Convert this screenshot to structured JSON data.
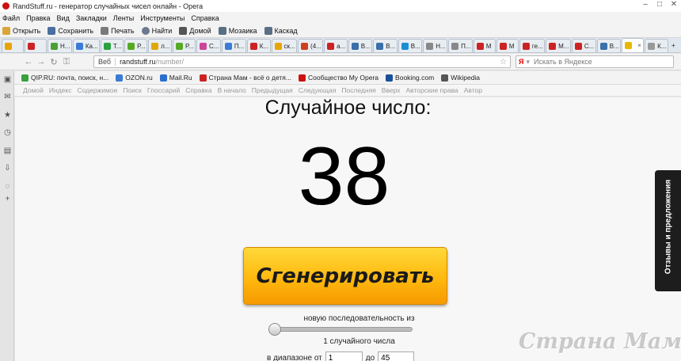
{
  "window": {
    "title": "RandStuff.ru - генератор случайных чисел онлайн - Opera"
  },
  "menu": [
    "Файл",
    "Правка",
    "Вид",
    "Закладки",
    "Ленты",
    "Инструменты",
    "Справка"
  ],
  "toolbar": [
    "Открыть",
    "Сохранить",
    "Печать",
    "Найти",
    "Домой",
    "Мозаика",
    "Каскад"
  ],
  "tabs": [
    {
      "label": "",
      "color": "#e8a400"
    },
    {
      "label": "",
      "color": "#cc2222"
    },
    {
      "label": "Н...",
      "color": "#4aa034"
    },
    {
      "label": "Ка...",
      "color": "#3a7bd5"
    },
    {
      "label": "Т...",
      "color": "#2aa040"
    },
    {
      "label": "Р...",
      "color": "#55aa22"
    },
    {
      "label": "л...",
      "color": "#e0a800"
    },
    {
      "label": "Р...",
      "color": "#55aa22"
    },
    {
      "label": "С...",
      "color": "#cc4499"
    },
    {
      "label": "П...",
      "color": "#3a7bd5"
    },
    {
      "label": "К...",
      "color": "#cc2222"
    },
    {
      "label": "ск...",
      "color": "#e8a400"
    },
    {
      "label": "(4...",
      "color": "#d04020"
    },
    {
      "label": "а...",
      "color": "#cc2222"
    },
    {
      "label": "В...",
      "color": "#3a6fa8"
    },
    {
      "label": "В...",
      "color": "#3a6fa8"
    },
    {
      "label": "В...",
      "color": "#1a8fd6"
    },
    {
      "label": "Н...",
      "color": "#888888"
    },
    {
      "label": "П...",
      "color": "#888888"
    },
    {
      "label": "М",
      "color": "#cc2222"
    },
    {
      "label": "М",
      "color": "#cc2222"
    },
    {
      "label": "ге...",
      "color": "#cc2222"
    },
    {
      "label": "М...",
      "color": "#cc2222"
    },
    {
      "label": "С...",
      "color": "#cc2222"
    },
    {
      "label": "В...",
      "color": "#3a6fa8"
    },
    {
      "label": "",
      "color": "#e8b800",
      "active": true
    },
    {
      "label": "К...",
      "color": "#999999"
    }
  ],
  "tab_add": "+",
  "address": {
    "badge": "Веб",
    "host": "randstuff.ru",
    "path": "/number/"
  },
  "search": {
    "placeholder": "Искать в Яндексе",
    "engine": "Я"
  },
  "bookmarks": [
    {
      "label": "QIP.RU: почта, поиск, н...",
      "color": "#3aa040"
    },
    {
      "label": "OZON.ru",
      "color": "#3a7bd5"
    },
    {
      "label": "Mail.Ru",
      "color": "#2a6fd0"
    },
    {
      "label": "Страна Мам - всё о детя...",
      "color": "#cc2222"
    },
    {
      "label": "Сообщество My Opera",
      "color": "#cc1111"
    },
    {
      "label": "Booking.com",
      "color": "#1a4f9c"
    },
    {
      "label": "Wikipedia",
      "color": "#555555"
    }
  ],
  "navbar": [
    "Домой",
    "Индекс",
    "Содержимое",
    "Поиск",
    "Глоссарий",
    "Справка",
    "В начало",
    "Предыдущая",
    "Следующая",
    "Последняя",
    "Вверх",
    "Авторские права",
    "Автор"
  ],
  "page": {
    "heading": "Случайное число:",
    "number": "38",
    "button": "Сгенерировать",
    "sequence_label": "новую последовательность из",
    "sequence_count": 1,
    "count_label": "1 случайного числа",
    "range_from_label": "в диапазоне от",
    "range_from": "1",
    "range_to_label": "до",
    "range_to": "45"
  },
  "feedback": "Отзывы и предложения",
  "watermark": "Страна Мам . ру"
}
